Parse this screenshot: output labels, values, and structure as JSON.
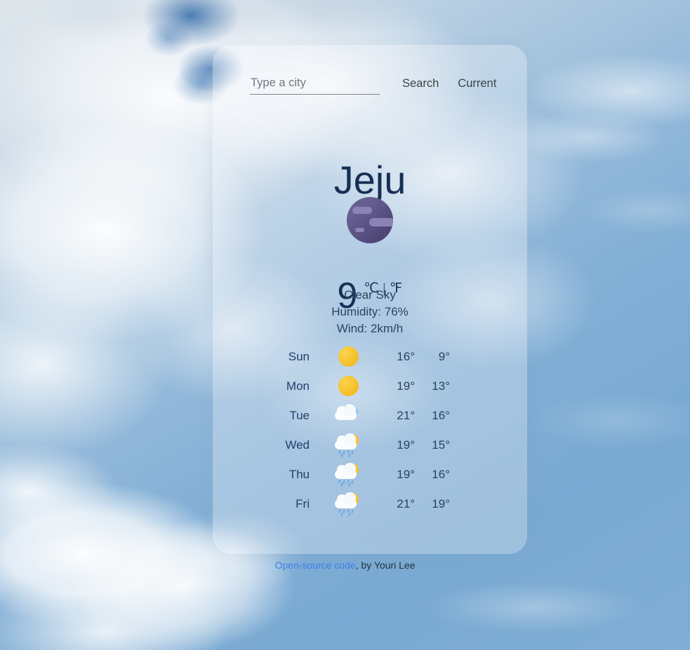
{
  "search": {
    "placeholder": "Type a city",
    "value": "",
    "search_label": "Search",
    "current_label": "Current"
  },
  "current": {
    "city": "Jeju",
    "icon": "moon-clear-night-icon",
    "temperature": "9",
    "units": "℃ | ℉",
    "condition": "Clear Sky",
    "humidity": "Humidity: 76%",
    "wind": "Wind: 2km/h"
  },
  "forecast": [
    {
      "day": "Sun",
      "icon": "sun-icon",
      "high": "16°",
      "low": "9°"
    },
    {
      "day": "Mon",
      "icon": "sun-icon",
      "high": "19°",
      "low": "13°"
    },
    {
      "day": "Tue",
      "icon": "cloud-icon",
      "high": "21°",
      "low": "16°"
    },
    {
      "day": "Wed",
      "icon": "sun-cloud-rain-icon",
      "high": "19°",
      "low": "15°"
    },
    {
      "day": "Thu",
      "icon": "sun-cloud-rain-icon",
      "high": "19°",
      "low": "16°"
    },
    {
      "day": "Fri",
      "icon": "sun-cloud-rain-icon",
      "high": "21°",
      "low": "19°"
    }
  ],
  "footer": {
    "link_text": "Open-source code",
    "suffix": ", by Youri Lee"
  },
  "colors": {
    "title": "#152f56",
    "text": "#2b4260",
    "link": "#3a82e6",
    "sun": "#f7c433",
    "moon": "#5a5187",
    "rain": "#6aa8e0"
  }
}
